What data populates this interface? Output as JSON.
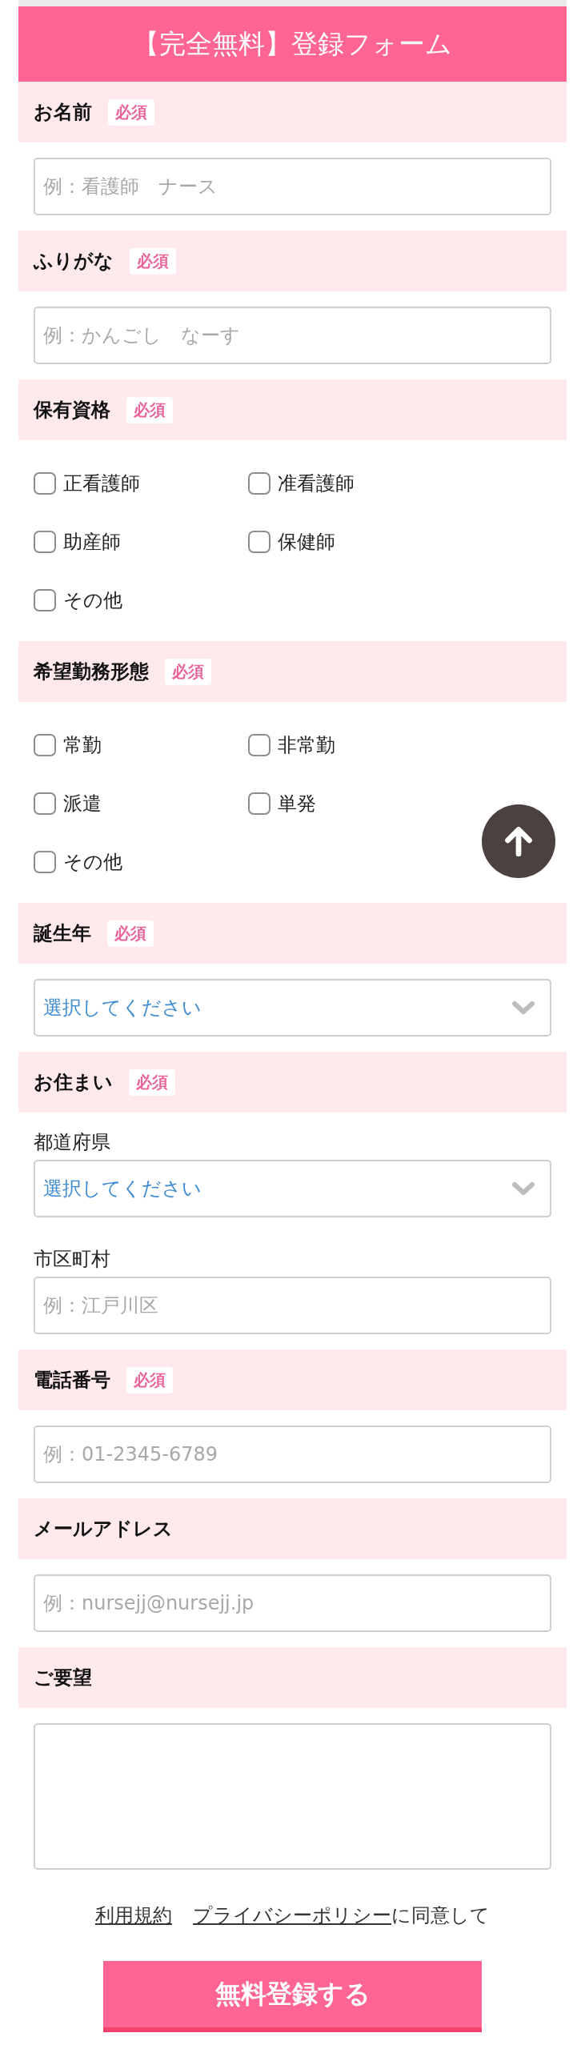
{
  "header": {
    "title": "【完全無料】登録フォーム"
  },
  "sections": [
    {
      "label": "お名前",
      "badge": "必須",
      "fields": [
        {
          "kind": "input",
          "placeholder": "例：看護師　ナース"
        }
      ]
    },
    {
      "label": "ふりがな",
      "badge": "必須",
      "fields": [
        {
          "kind": "input",
          "placeholder": "例：かんごし　なーす"
        }
      ]
    },
    {
      "label": "保有資格",
      "badge": "必須",
      "fields": [
        {
          "kind": "checkboxes",
          "options": [
            {
              "label": "正看護師",
              "checked": false
            },
            {
              "label": "准看護師",
              "checked": false
            },
            {
              "label": "助産師",
              "checked": false
            },
            {
              "label": "保健師",
              "checked": false
            },
            {
              "label": "その他",
              "checked": false
            }
          ]
        }
      ]
    },
    {
      "label": "希望勤務形態",
      "badge": "必須",
      "fields": [
        {
          "kind": "checkboxes",
          "options": [
            {
              "label": "常勤",
              "checked": false
            },
            {
              "label": "非常勤",
              "checked": false
            },
            {
              "label": "派遣",
              "checked": false
            },
            {
              "label": "単発",
              "checked": false
            },
            {
              "label": "その他",
              "checked": false
            }
          ]
        }
      ]
    },
    {
      "label": "誕生年",
      "badge": "必須",
      "fields": [
        {
          "kind": "select",
          "value": "選択してください"
        }
      ]
    },
    {
      "label": "お住まい",
      "badge": "必須",
      "fields": [
        {
          "kind": "select",
          "label": "都道府県",
          "value": "選択してください"
        },
        {
          "kind": "input",
          "label": "市区町村",
          "placeholder": "例：江戸川区"
        }
      ]
    },
    {
      "label": "電話番号",
      "badge": "必須",
      "fields": [
        {
          "kind": "input",
          "placeholder": "例：01-2345-6789"
        }
      ]
    },
    {
      "label": "メールアドレス",
      "fields": [
        {
          "kind": "input",
          "placeholder": "例：nursejj@nursejj.jp"
        }
      ]
    },
    {
      "label": "ご要望",
      "fields": [
        {
          "kind": "textarea"
        }
      ]
    }
  ],
  "agreement": {
    "links": [
      {
        "label": "利用規約"
      },
      {
        "label": "プライバシーポリシー"
      }
    ],
    "text": "に同意して"
  },
  "submit_button": {
    "label": "無料登録する"
  }
}
